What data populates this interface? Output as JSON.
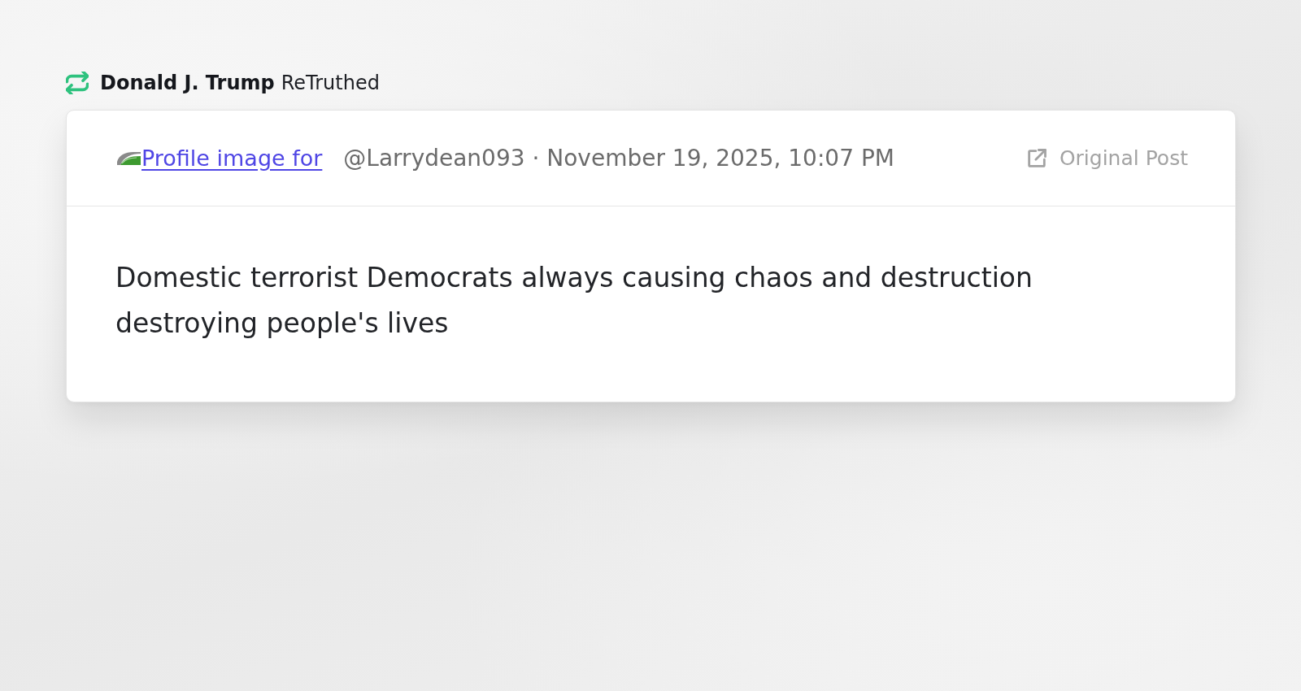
{
  "retruth": {
    "author": "Donald J. Trump",
    "action": "ReTruthed"
  },
  "post": {
    "profile_image_alt": "Profile image for",
    "meta": "@Larrydean093 · November 19, 2025, 10:07 PM",
    "original_post_link": "Original Post",
    "text": "Domestic terrorist Democrats always causing chaos and destruction destroying people's lives"
  }
}
